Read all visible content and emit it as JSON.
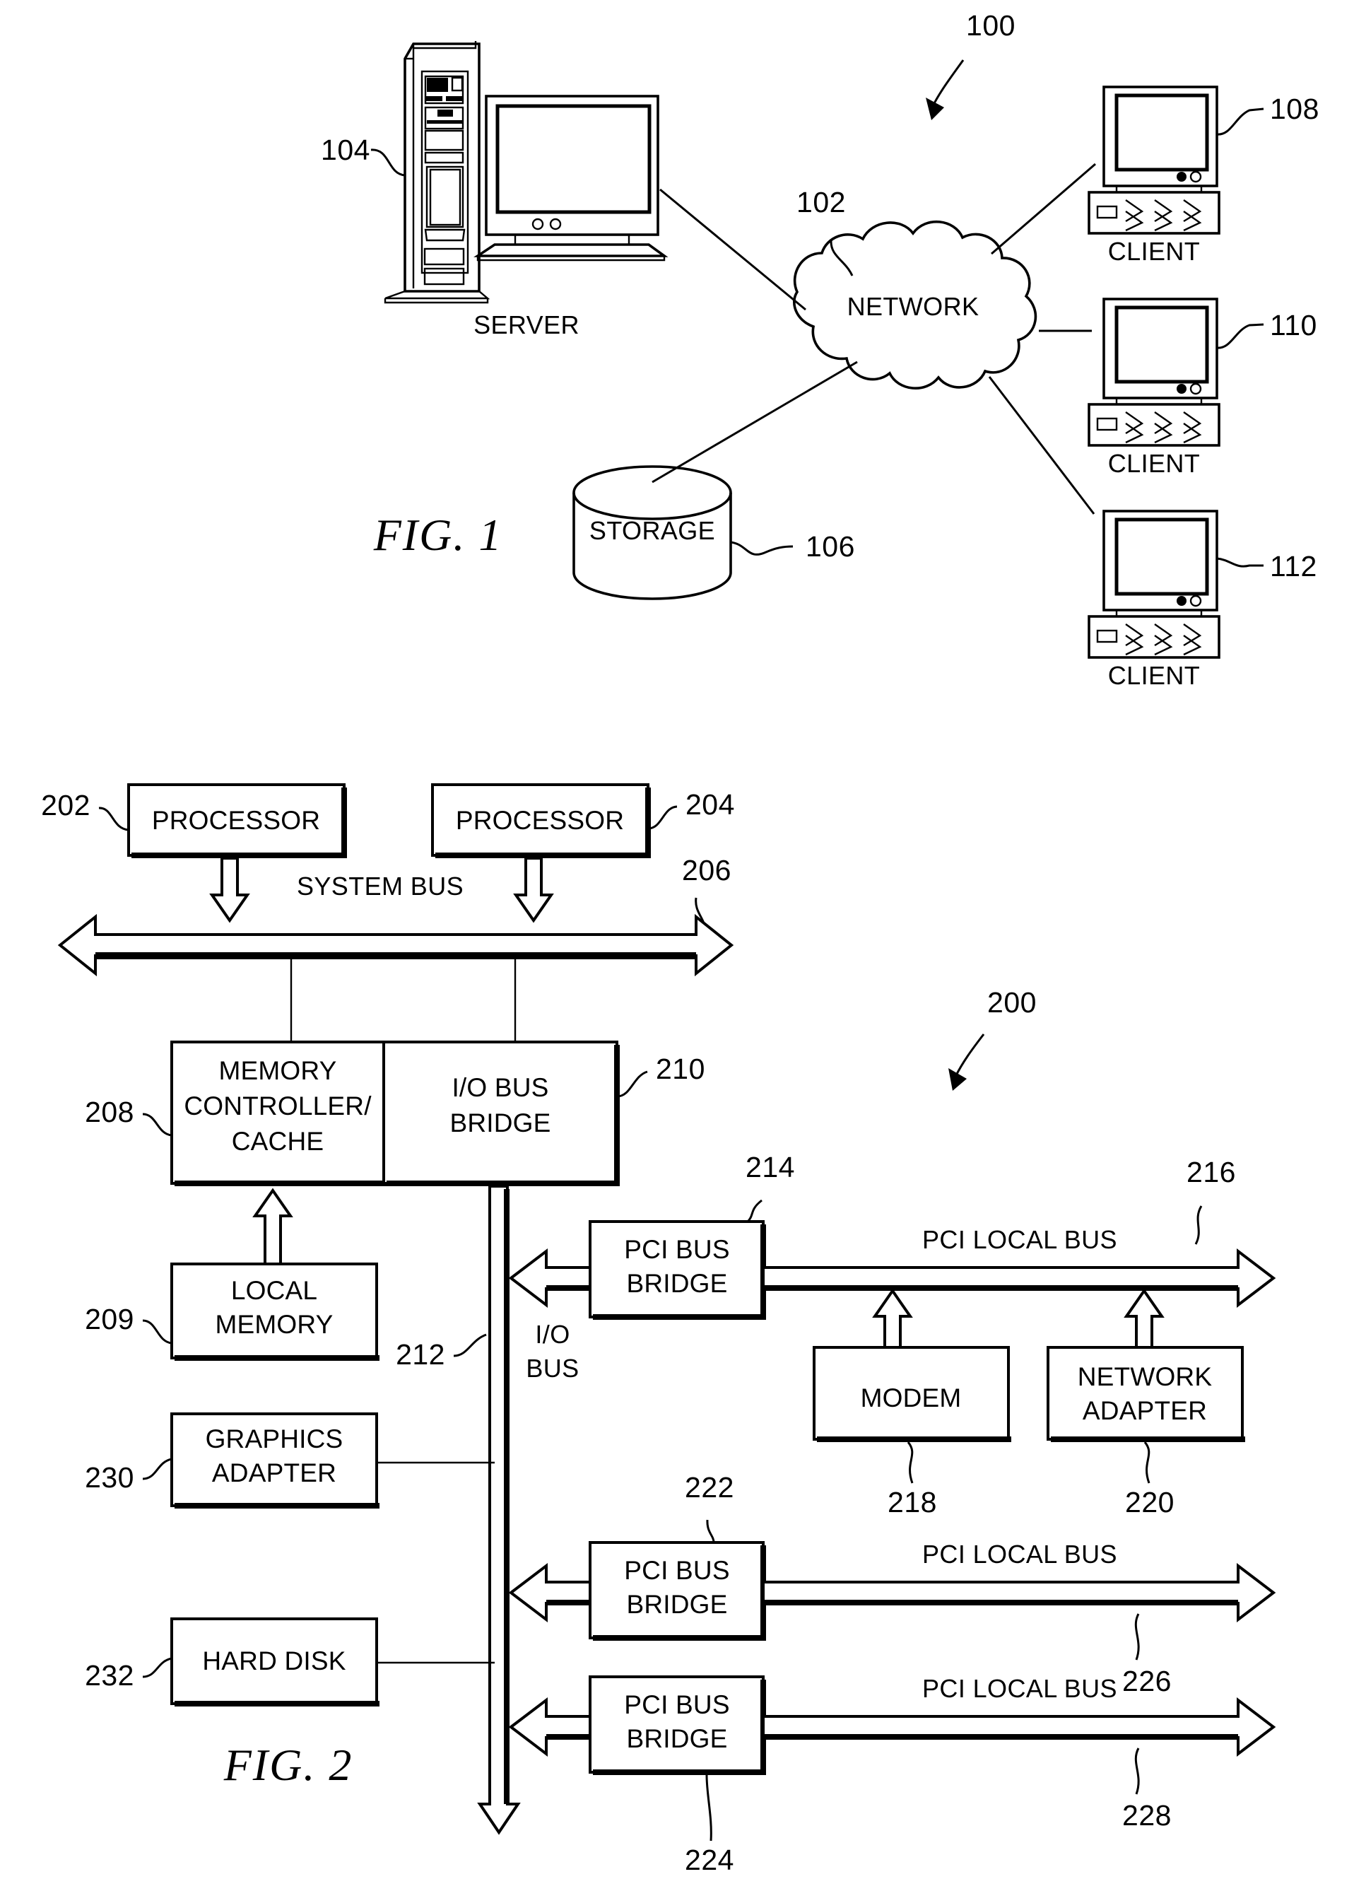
{
  "document": {
    "kind": "patent-figure-sheet",
    "figures": [
      "FIG. 1",
      "FIG. 2"
    ]
  },
  "figure1": {
    "caption": "FIG. 1",
    "system_ref": "100",
    "nodes": {
      "server": {
        "label": "SERVER",
        "ref": "104"
      },
      "network": {
        "label": "NETWORK",
        "ref": "102"
      },
      "storage": {
        "label": "STORAGE",
        "ref": "106"
      },
      "client1": {
        "label": "CLIENT",
        "ref": "108"
      },
      "client2": {
        "label": "CLIENT",
        "ref": "110"
      },
      "client3": {
        "label": "CLIENT",
        "ref": "112"
      }
    }
  },
  "figure2": {
    "caption": "FIG. 2",
    "system_ref": "200",
    "blocks": {
      "processor1": {
        "label": "PROCESSOR",
        "ref": "202"
      },
      "processor2": {
        "label": "PROCESSOR",
        "ref": "204"
      },
      "memory_controller": {
        "line1": "MEMORY",
        "line2": "CONTROLLER/",
        "line3": "CACHE",
        "ref": "208"
      },
      "io_bus_bridge": {
        "line1": "I/O BUS",
        "line2": "BRIDGE",
        "ref": "210"
      },
      "local_memory": {
        "line1": "LOCAL",
        "line2": "MEMORY",
        "ref": "209"
      },
      "graphics_adapter": {
        "line1": "GRAPHICS",
        "line2": "ADAPTER",
        "ref": "230"
      },
      "hard_disk": {
        "label": "HARD DISK",
        "ref": "232"
      },
      "pci_bus_bridge_1": {
        "line1": "PCI BUS",
        "line2": "BRIDGE",
        "ref": "214"
      },
      "pci_bus_bridge_2": {
        "line1": "PCI BUS",
        "line2": "BRIDGE",
        "ref": "222"
      },
      "pci_bus_bridge_3": {
        "line1": "PCI BUS",
        "line2": "BRIDGE",
        "ref": "224"
      },
      "modem": {
        "label": "MODEM",
        "ref": "218"
      },
      "network_adapter": {
        "line1": "NETWORK",
        "line2": "ADAPTER",
        "ref": "220"
      }
    },
    "buses": {
      "system_bus": {
        "label": "SYSTEM BUS",
        "ref": "206"
      },
      "io_bus": {
        "line1": "I/O",
        "line2": "BUS",
        "ref": "212"
      },
      "pci_local_bus_1": {
        "label": "PCI LOCAL BUS",
        "ref": "216"
      },
      "pci_local_bus_2": {
        "label": "PCI LOCAL BUS",
        "ref": "226"
      },
      "pci_local_bus_3": {
        "label": "PCI LOCAL BUS",
        "ref": "228"
      }
    }
  },
  "colors": {
    "ink": "#000000",
    "paper": "#ffffff"
  }
}
